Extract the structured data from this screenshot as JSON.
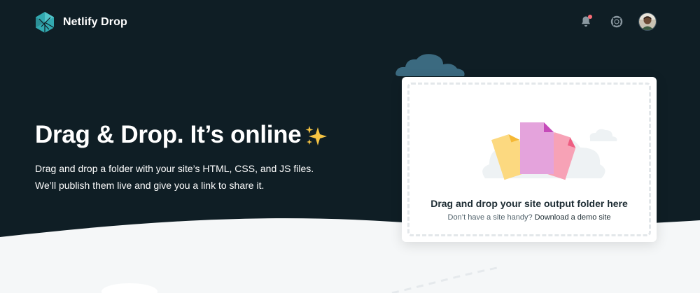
{
  "header": {
    "brand_title": "Netlify Drop",
    "icons": {
      "brand": "netlify-logo-icon",
      "notifications": "bell-icon",
      "help": "lifebuoy-icon",
      "user": "avatar"
    },
    "notification_dot_color": "#fb6d77"
  },
  "hero": {
    "title": "Drag & Drop. It’s online",
    "title_emoji_icon": "sparkles-icon",
    "subtitle_line1": "Drag and drop a folder with your site’s HTML, CSS, and JS files.",
    "subtitle_line2": "We’ll publish them live and give you a link to share it."
  },
  "dropzone": {
    "title": "Drag and drop your site output folder here",
    "prompt": "Don’t have a site handy?",
    "link_label": "Download a demo site"
  },
  "colors": {
    "background_dark": "#0f1e25",
    "accent_teal": "#3aa0a7",
    "text_primary": "#1c2b32"
  }
}
